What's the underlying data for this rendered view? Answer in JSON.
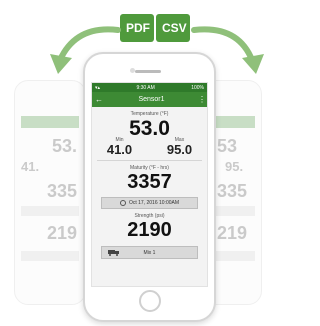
{
  "badges": {
    "pdf": "PDF",
    "csv": "CSV"
  },
  "status_bar": {
    "time": "9:30 AM",
    "battery": "100%"
  },
  "app_bar": {
    "title": "Sensor1"
  },
  "temperature": {
    "label": "Temperature (°F)",
    "value": "53.0"
  },
  "min": {
    "label": "Min",
    "value": "41.0"
  },
  "max": {
    "label": "Max",
    "value": "95.0"
  },
  "maturity": {
    "label": "Maturity (°F - hrs)",
    "value": "3357"
  },
  "date": {
    "text": "Oct 17, 2016 10:00AM"
  },
  "strength": {
    "label": "Strength (psi)",
    "value": "2190"
  },
  "mix": {
    "label": "Mix 1"
  },
  "ghost_left": {
    "v1": "53.",
    "v2": "41.",
    "v3": "335",
    "v4": "219"
  },
  "ghost_right": {
    "v1": "53",
    "v2": "95.",
    "v3": "335",
    "v4": "219"
  },
  "colors": {
    "accent": "#3d8a34",
    "badge": "#4f9a3c",
    "arrow": "#8fc07a"
  }
}
